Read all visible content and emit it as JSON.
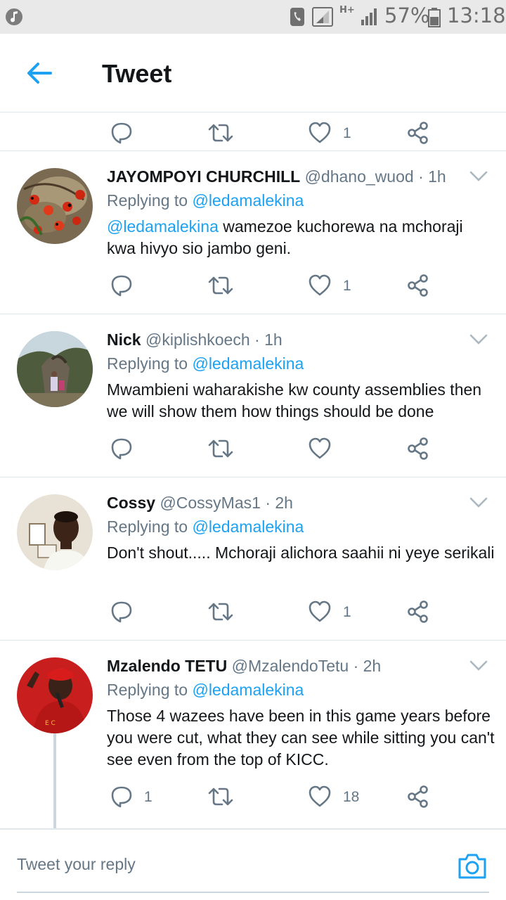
{
  "status_bar": {
    "battery_percent": "57%",
    "time": "13:18",
    "network": "H+"
  },
  "header": {
    "title": "Tweet"
  },
  "top_partial": {
    "like_count": "1"
  },
  "tweets": [
    {
      "name": "JAYOMPOYI CHURCHILL",
      "handle": "@dhano_wuod",
      "time": "· 1h",
      "replying_label": "Replying to",
      "replying_to": "@ledamalekina",
      "text_mention": "@ledamalekina",
      "text": " wamezoe kuchorewa na mchoraji kwa hivyo sio jambo geni.",
      "reply_count": "",
      "like_count": "1"
    },
    {
      "name": "Nick",
      "handle": "@kiplishkoech",
      "time": "· 1h",
      "replying_label": "Replying to",
      "replying_to": "@ledamalekina",
      "text": "Mwambieni waharakishe kw county assemblies then we will show them how things should be done",
      "reply_count": "",
      "like_count": ""
    },
    {
      "name": "Cossy",
      "handle": "@CossyMas1",
      "time": "· 2h",
      "replying_label": "Replying to",
      "replying_to": "@ledamalekina",
      "text": "Don't shout..... Mchoraji alichora saahii ni yeye serikali",
      "reply_count": "",
      "like_count": "1"
    },
    {
      "name": "Mzalendo TETU",
      "handle": "@MzalendoTetu",
      "time": "· 2h",
      "replying_label": "Replying to",
      "replying_to": "@ledamalekina",
      "text": "Those 4 wazees have been in this game years before you were cut, what they can see while sitting you can't see even from the top of KICC.",
      "reply_count": "1",
      "like_count": "18"
    }
  ],
  "reply_bar": {
    "placeholder": "Tweet your reply"
  },
  "colors": {
    "accent": "#1da1f2",
    "secondary_text": "#657786",
    "icon_gray": "#657786"
  }
}
